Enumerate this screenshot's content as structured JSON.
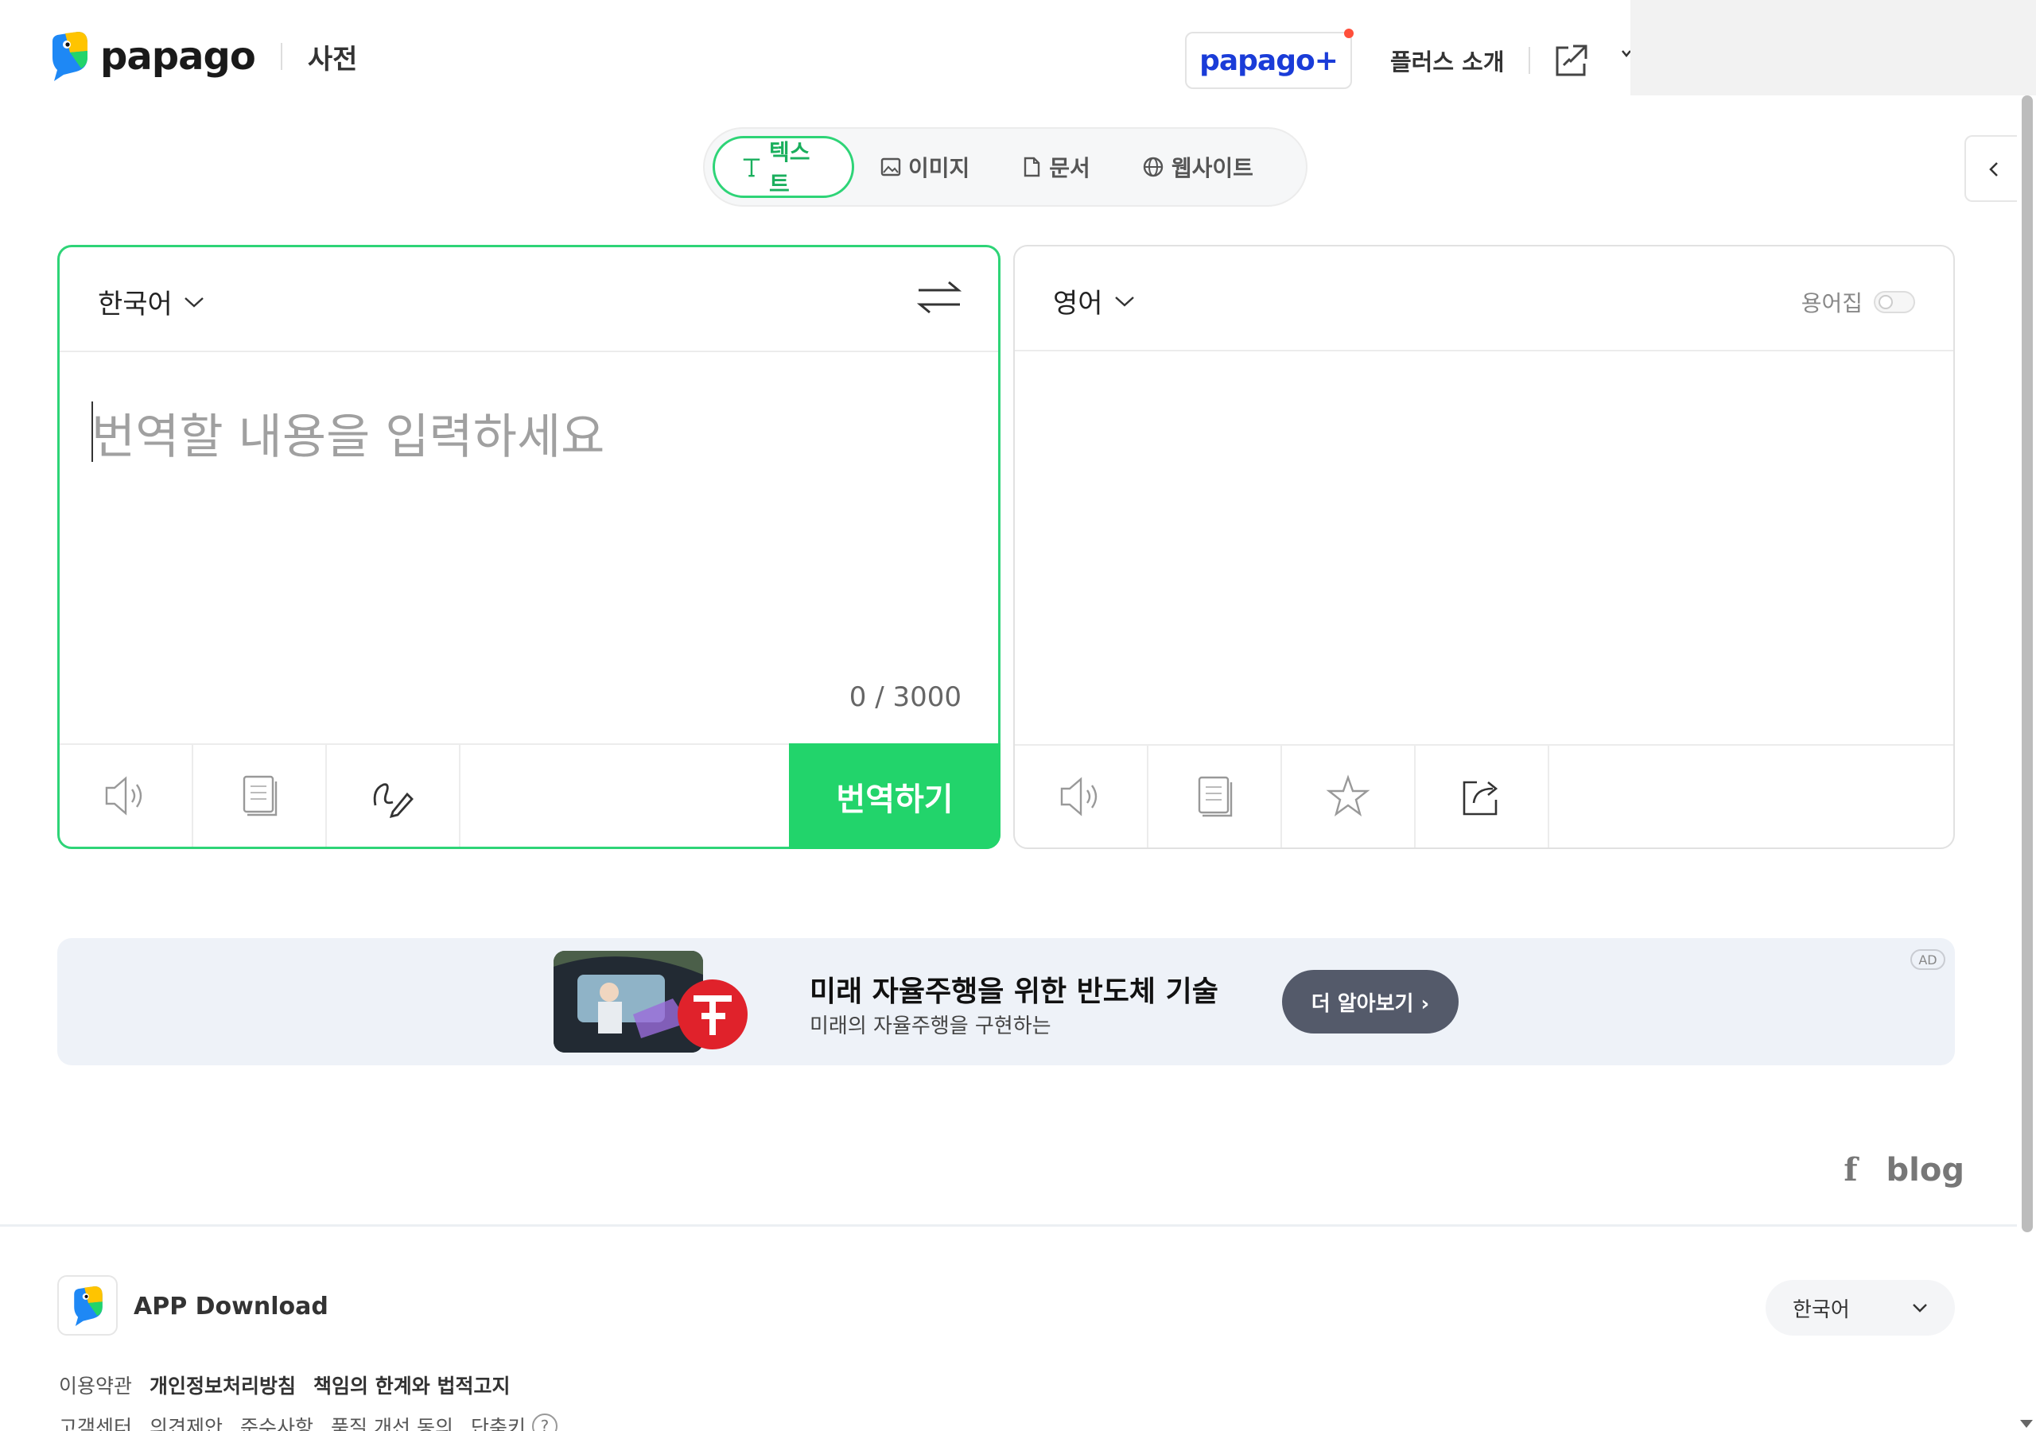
{
  "header": {
    "logo_text": "papago",
    "dict_label": "사전",
    "plus_label": "papago+",
    "plus_intro": "플러스 소개"
  },
  "tabs": [
    {
      "label": "텍스트",
      "icon": "text-icon",
      "active": true
    },
    {
      "label": "이미지",
      "icon": "image-icon",
      "active": false
    },
    {
      "label": "문서",
      "icon": "document-icon",
      "active": false
    },
    {
      "label": "웹사이트",
      "icon": "globe-icon",
      "active": false
    }
  ],
  "source": {
    "language": "한국어",
    "placeholder": "번역할 내용을 입력하세요",
    "counter": "0 / 3000",
    "translate_label": "번역하기"
  },
  "target": {
    "language": "영어",
    "glossary_label": "용어집"
  },
  "ad": {
    "title": "미래 자율주행을 위한 반도체 기술",
    "subtitle": "미래의 자율주행을 구현하는",
    "cta": "더 알아보기 ›",
    "tag": "AD"
  },
  "social": {
    "facebook": "f",
    "blog": "blog"
  },
  "footer": {
    "app_download": "APP Download",
    "language": "한국어",
    "links_row1": [
      "이용약관",
      "개인정보처리방침",
      "책임의 한계와 법적고지"
    ],
    "links_row2": [
      "고객센터",
      "의견제안",
      "준수사항",
      "품질 개선 동의",
      "단축키"
    ]
  },
  "colors": {
    "accent": "#22d46b",
    "plus_blue": "#1a3cd8",
    "ad_bg": "#eef2f8"
  }
}
